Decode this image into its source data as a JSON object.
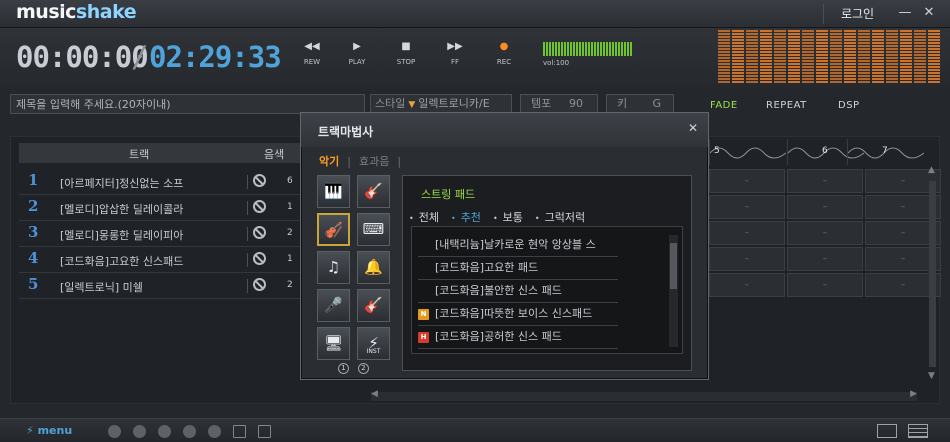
{
  "app": {
    "logo_main": "music",
    "logo_accent": "shake",
    "login_label": "로그인",
    "minimize_glyph": "—",
    "close_glyph": "✕"
  },
  "transport": {
    "time_current": "00:00:00",
    "time_separator": "/",
    "time_total": "02:29:33",
    "buttons": [
      {
        "label": "REW",
        "icon": "◀◀"
      },
      {
        "label": "PLAY",
        "icon": "▶"
      },
      {
        "label": "STOP",
        "icon": "■"
      },
      {
        "label": "FF",
        "icon": "▶▶"
      },
      {
        "label": "REC",
        "icon": "●"
      }
    ],
    "volume_label": "vol:100",
    "volume": 100,
    "accent_meter_color": "#6ec52b",
    "accent_spectrum_color": "#e07b2a"
  },
  "info": {
    "title_placeholder": "제목을 입력해 주세요.(20자이내)",
    "style_label": "스타일",
    "style_value": "일렉트로니카/E",
    "tempo_label": "템포",
    "tempo_value": "90",
    "key_label": "키",
    "key_value": "G",
    "fade_label": "FADE",
    "repeat_label": "REPEAT",
    "dsp_label": "DSP"
  },
  "tracks": {
    "header_track": "트랙",
    "header_color": "음색",
    "items": [
      {
        "num": "1",
        "name": "[아르페지터]정신없는 소프",
        "color": "6"
      },
      {
        "num": "2",
        "name": "[멜로디]압삽한 딜레이콜라",
        "color": "1"
      },
      {
        "num": "3",
        "name": "[멜로디]몽롱한 딜레이피아",
        "color": "2"
      },
      {
        "num": "4",
        "name": "[코드화음]고요한 신스패드",
        "color": "1"
      },
      {
        "num": "5",
        "name": "[일렉트로닉] 미쉘",
        "color": "2"
      }
    ]
  },
  "timeline": {
    "markers": [
      "5",
      "6",
      "7"
    ],
    "empty_cell": "–"
  },
  "footer": {
    "menu_label": "menu"
  },
  "wizard": {
    "title": "트랙마법사",
    "close_glyph": "✕",
    "tab_instrument": "악기",
    "tab_effects": "효과음",
    "tab_separator": "|",
    "instruments": [
      {
        "icon": "🎹",
        "name": "piano"
      },
      {
        "icon": "🎸",
        "name": "acoustic-guitar"
      },
      {
        "icon": "🎻",
        "name": "strings"
      },
      {
        "icon": "⌨",
        "name": "synth-keyboard"
      },
      {
        "icon": "♫",
        "name": "notes"
      },
      {
        "icon": "🔔",
        "name": "bell"
      },
      {
        "icon": "🎤",
        "name": "microphone"
      },
      {
        "icon": "🎸",
        "name": "electric-guitar"
      },
      {
        "icon": "🖥",
        "name": "computer"
      },
      {
        "icon": "⚡",
        "name": "inst",
        "small": "INST"
      }
    ],
    "pages": [
      "1",
      "2"
    ],
    "panel_heading": "스트링 패드",
    "filters": [
      "전체",
      "추천",
      "보통",
      "그럭저럭"
    ],
    "active_filter": "추천",
    "list": [
      {
        "text": "[내택리늄]날카로운 현악 앙상블 스",
        "badge": ""
      },
      {
        "text": "[코드화음]고요한 패드",
        "badge": ""
      },
      {
        "text": "[코드화음]불안한 신스 패드",
        "badge": ""
      },
      {
        "text": "[코드화음]따뜻한 보이스 신스패드",
        "badge": "N"
      },
      {
        "text": "[코드화음]공허한 신스 패드",
        "badge": "H"
      }
    ]
  }
}
